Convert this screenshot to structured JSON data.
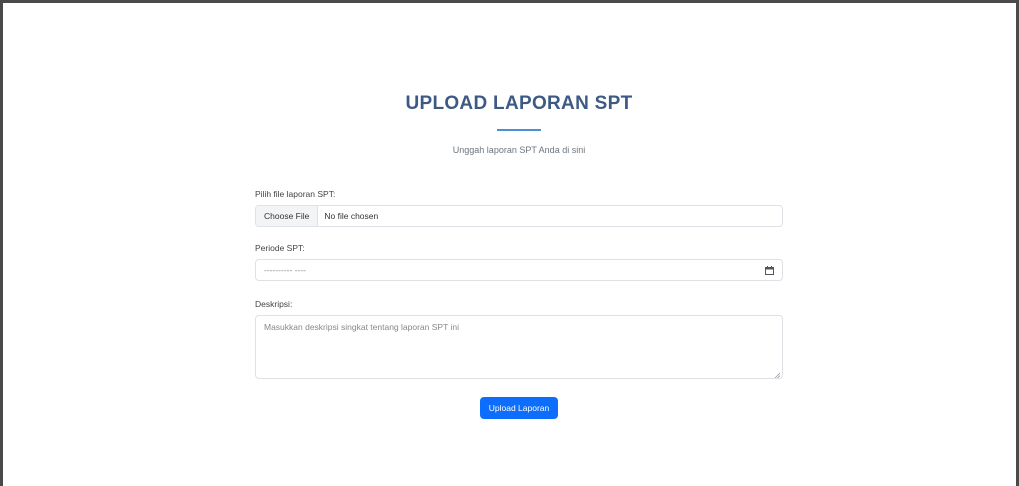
{
  "header": {
    "title": "UPLOAD LAPORAN SPT",
    "subtitle": "Unggah laporan SPT Anda di sini"
  },
  "form": {
    "file": {
      "label": "Pilih file laporan SPT:",
      "button_label": "Choose File",
      "status": "No file chosen"
    },
    "period": {
      "label": "Periode SPT:",
      "placeholder": "---------- ----"
    },
    "description": {
      "label": "Deskripsi:",
      "placeholder": "Masukkan deskripsi singkat tentang laporan SPT ini"
    },
    "submit_label": "Upload Laporan"
  },
  "colors": {
    "title": "#3d5a85",
    "accent": "#4a90d9",
    "button": "#0d6efd"
  },
  "icons": {
    "date_picker": "calendar-icon"
  }
}
